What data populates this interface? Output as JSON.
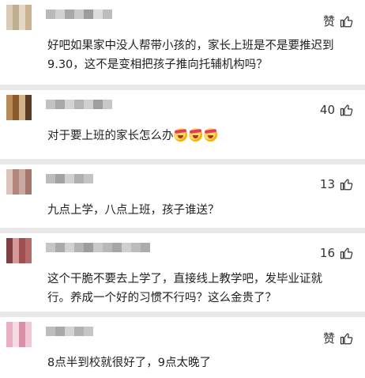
{
  "comments": [
    {
      "like": "赞",
      "text": "好吧如果家中没人帮带小孩的，家长上班是不是要推迟到\n9.30，这不是变相把孩子推向托辅机构吗？",
      "emoji_count": 0,
      "avatar_colors": [
        "#d9cbb7",
        "#c9b392",
        "#e4d7c5",
        "#bfae90"
      ],
      "name_colors": [
        "#b9b9b9",
        "#d1d1d1",
        "#a7a7a7",
        "#c9c9c9",
        "#9c9c9c",
        "#dcdcdc",
        "#bdbdbd"
      ]
    },
    {
      "like": "40",
      "text": "对于要上班的家长怎么办",
      "emoji_count": 3,
      "avatar_colors": [
        "#8b5a2b",
        "#b88a5a",
        "#5b3b22",
        "#d2b48c"
      ],
      "name_colors": [
        "#c2c2c2",
        "#a9a9a9",
        "#d4d4d4",
        "#b5b5b5",
        "#cfcfcf",
        "#9f9f9f",
        "#c8c8c8"
      ]
    },
    {
      "like": "13",
      "text": "九点上学，八点上班，孩子谁送？",
      "emoji_count": 0,
      "avatar_colors": [
        "#c9a9a0",
        "#b3877d",
        "#dcc3bc",
        "#a5766b"
      ],
      "name_colors": [
        "#bcbcbc",
        "#a3a3a3",
        "#d0d0d0",
        "#b0b0b0",
        "#c4c4c4"
      ]
    },
    {
      "like": "16",
      "text": "这个干脆不要去上学了，直接线上教学吧，发毕业证就\n行。养成一个好的习惯不行吗？这么金贵了？",
      "emoji_count": 0,
      "avatar_colors": [
        "#b66a6a",
        "#9e4f4f",
        "#d49a9a",
        "#7f3f3f"
      ],
      "name_colors": [
        "#c6c6c6",
        "#aaaaaa",
        "#d2d2d2",
        "#b3b3b3",
        "#9d9d9d",
        "#c9c9c9",
        "#b8b8b8",
        "#a6a6a6",
        "#cfcfcf",
        "#bcbcbc",
        "#acacac"
      ]
    },
    {
      "like": "赞",
      "text": "8点半到校就很好了，9点太晚了",
      "emoji_count": 0,
      "avatar_colors": [
        "#e8b0c0",
        "#f2c7d3",
        "#d990a6",
        "#f6dbe3"
      ],
      "name_colors": [
        "#bdbdbd",
        "#a8a8a8",
        "#d3d3d3",
        "#b2b2b2",
        "#c6c6c6"
      ]
    }
  ]
}
